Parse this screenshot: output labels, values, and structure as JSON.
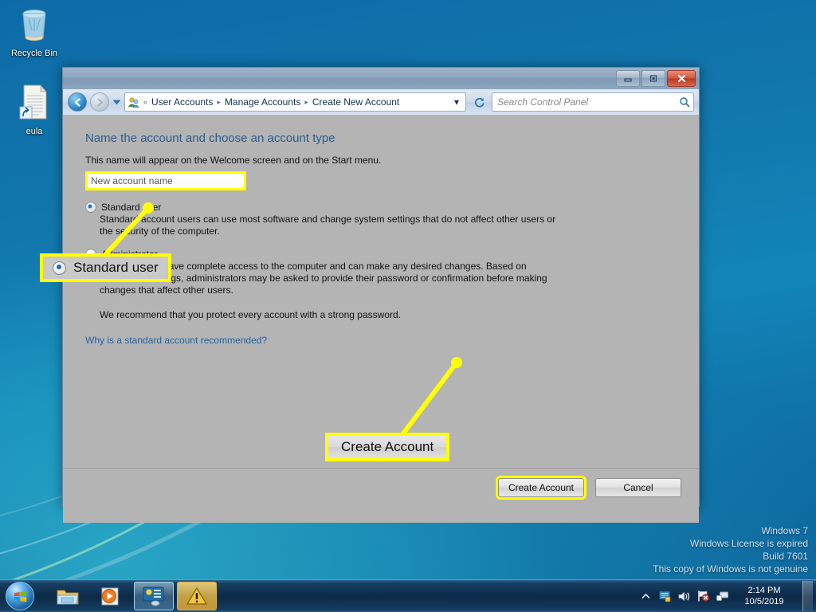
{
  "desktop": {
    "icons": [
      {
        "name": "Recycle Bin",
        "icon": "recycle-bin-icon"
      },
      {
        "name": "eula",
        "icon": "text-file-shortcut-icon"
      }
    ],
    "watermark": {
      "line1": "Windows 7",
      "line2": "Windows License is expired",
      "line3": "Build 7601",
      "line4": "This copy of Windows is not genuine"
    }
  },
  "window": {
    "titlebar": {
      "minimize": "Minimize",
      "maximize": "Maximize",
      "close": "Close"
    },
    "nav": {
      "back": "Back",
      "forward": "Forward",
      "recent_pages": "Recent pages",
      "refresh": "Refresh",
      "breadcrumb_icon": "user-accounts-icon",
      "overflow": "«",
      "crumbs": [
        {
          "label": "User Accounts"
        },
        {
          "label": "Manage Accounts"
        },
        {
          "label": "Create New Account"
        }
      ],
      "separator": "▸",
      "dropdown": "▾"
    },
    "search": {
      "placeholder": "Search Control Panel",
      "icon": "search-icon"
    }
  },
  "page": {
    "heading": "Name the account and choose an account type",
    "subtext": "This name will appear on the Welcome screen and on the Start menu.",
    "name_field": {
      "value": "New account name",
      "placeholder": "New account name",
      "highlighted": true
    },
    "account_types": [
      {
        "label": "Standard user",
        "selected": true,
        "description": "Standard account users can use most software and change system settings that do not affect other users or the security of the computer."
      },
      {
        "label": "Administrator",
        "selected": false,
        "description": "Administrators have complete access to the computer and can make any desired changes. Based on notification settings, administrators may be asked to provide their password or confirmation before making changes that affect other users."
      }
    ],
    "recommendation": "We recommend that you protect every account with a strong password.",
    "help_link": "Why is a standard account recommended?",
    "buttons": {
      "primary": "Create Account",
      "secondary": "Cancel"
    }
  },
  "annotations": [
    {
      "id": "standard-user-callout",
      "text": "Standard user",
      "icon": "radio-selected-icon"
    },
    {
      "id": "create-account-callout",
      "text": "Create Account",
      "icon": "none"
    }
  ],
  "taskbar": {
    "start": "Start",
    "items": [
      {
        "name": "Windows Explorer",
        "icon": "folder-icon",
        "state": "pinned"
      },
      {
        "name": "Windows Media Player",
        "icon": "media-player-icon",
        "state": "pinned"
      },
      {
        "name": "Control Panel",
        "icon": "control-panel-icon",
        "state": "active"
      },
      {
        "name": "Windows Alert",
        "icon": "warning-triangle-icon",
        "state": "alert"
      }
    ],
    "tray": {
      "show_hidden": "Show hidden icons",
      "icons": [
        {
          "name": "action-center-icon"
        },
        {
          "name": "volume-icon"
        },
        {
          "name": "network-flag-icon"
        },
        {
          "name": "network-icon"
        }
      ],
      "time": "2:14 PM",
      "date": "10/5/2019",
      "show_desktop": "Show desktop"
    }
  },
  "colors": {
    "highlight": "#ffff00",
    "link": "#26659e",
    "heading": "#2b5c8a",
    "content_bg": "#b4b4b4",
    "close_button": "#c74a2e"
  }
}
